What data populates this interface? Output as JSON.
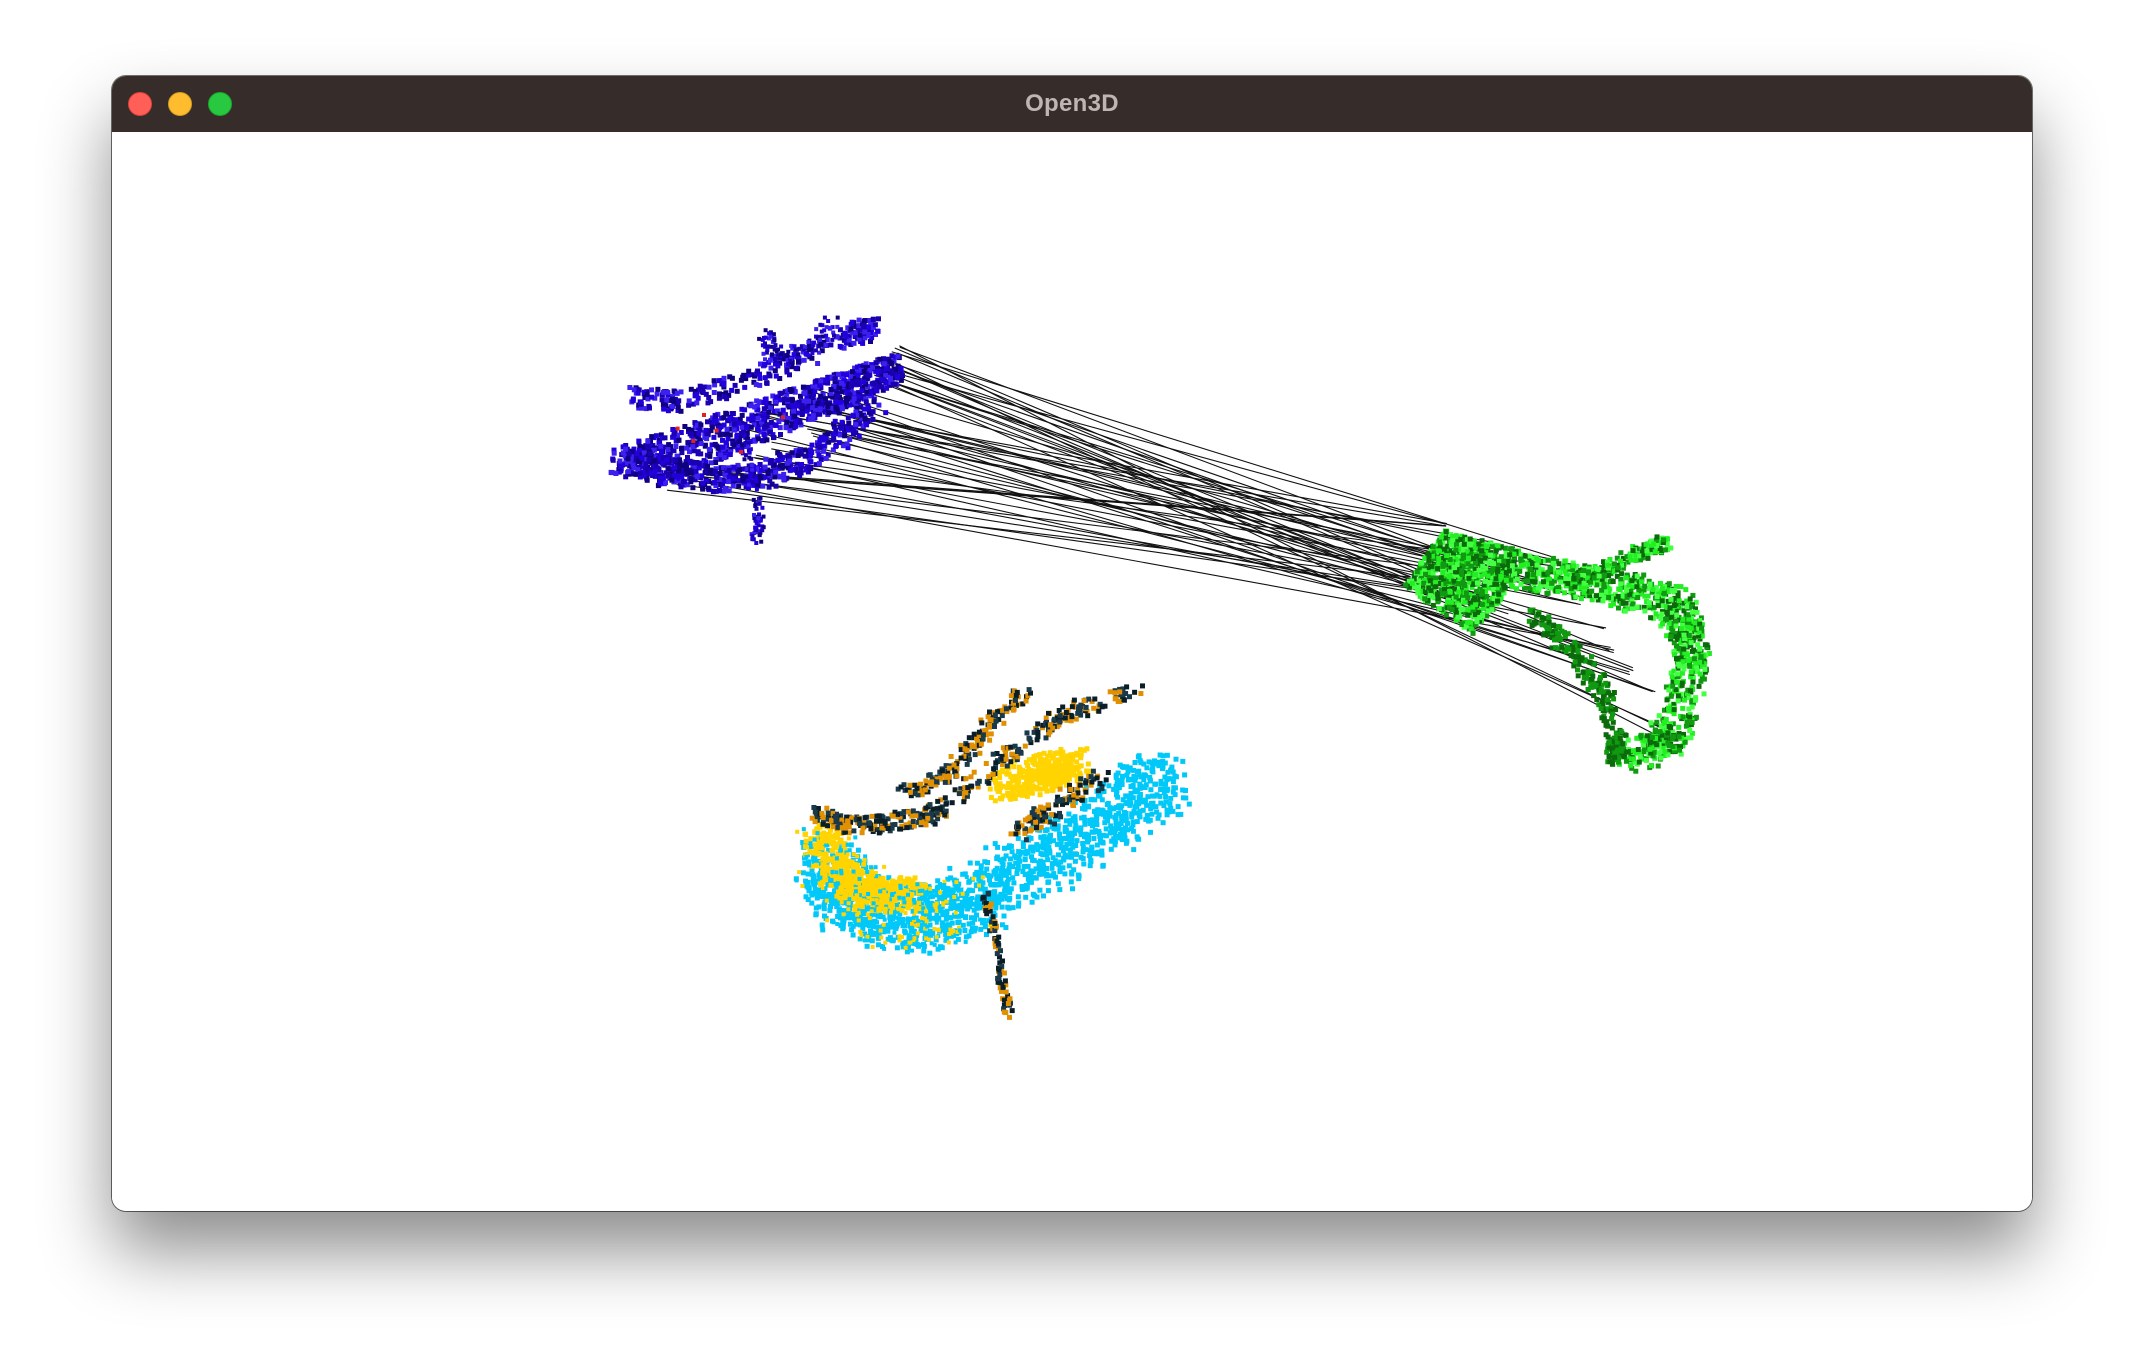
{
  "window": {
    "title": "Open3D",
    "controls": [
      {
        "name": "close",
        "color": "#ff5f57"
      },
      {
        "name": "minimize",
        "color": "#febc2e"
      },
      {
        "name": "maximize",
        "color": "#28c840"
      }
    ]
  },
  "scene": {
    "background": "#ffffff",
    "point_clouds": [
      {
        "name": "source-cloud",
        "colors": [
          "#2200dd",
          "#1a00b0",
          "#3b20f0",
          "#0f0080",
          "#dd2222"
        ]
      },
      {
        "name": "target-cloud",
        "colors": [
          "#22ee22",
          "#119911",
          "#0b6b0b",
          "#44ff44"
        ]
      },
      {
        "name": "registered-cloud",
        "colors": [
          "#00c8f8",
          "#ffd400",
          "#e09000",
          "#1a3a4a",
          "#0a1e28"
        ]
      }
    ],
    "correspondence_lines": {
      "color": "#111111"
    }
  }
}
